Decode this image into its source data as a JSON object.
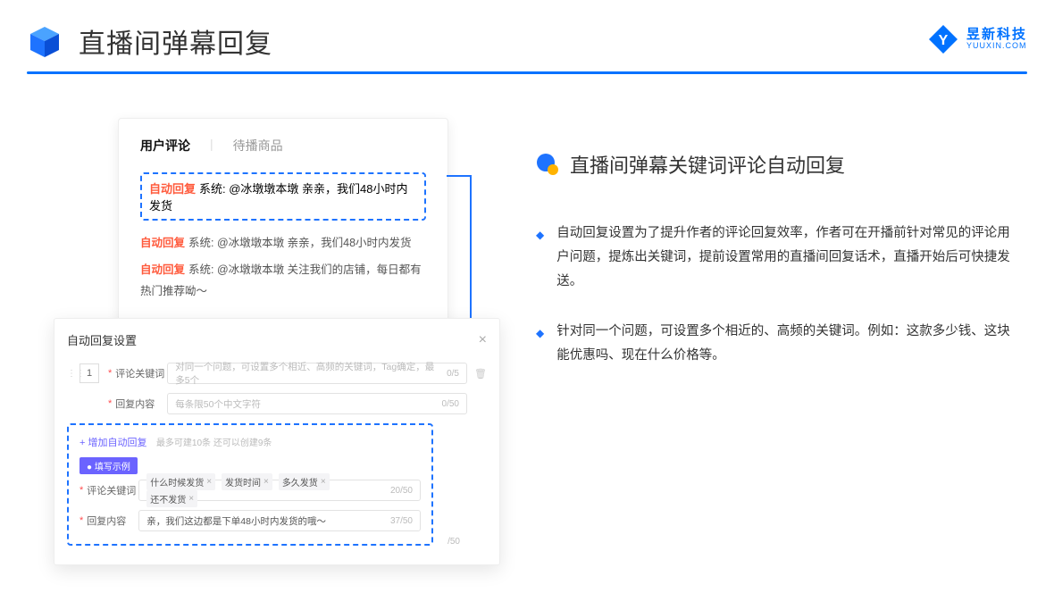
{
  "header": {
    "title": "直播间弹幕回复",
    "brand_name": "昱新科技",
    "brand_sub": "YUUXIN.COM"
  },
  "comments_card": {
    "tab_active": "用户评论",
    "tab_inactive": "待播商品",
    "row_hl": "系统: @冰墩墩本墩 亲亲，我们48小时内发货",
    "row2": "系统: @冰墩墩本墩 亲亲，我们48小时内发货",
    "row3": "系统: @冰墩墩本墩 关注我们的店铺，每日都有热门推荐呦～",
    "auto_tag": "自动回复"
  },
  "settings": {
    "title": "自动回复设置",
    "idx": "1",
    "label_kw": "评论关键词",
    "label_reply": "回复内容",
    "ph_kw": "对同一个问题，可设置多个相近、高频的关键词，Tag确定，最多5个",
    "cnt_kw": "0/5",
    "ph_reply": "每条限50个中文字符",
    "cnt_reply": "0/50",
    "add_link": "+ 增加自动回复",
    "add_hint": "最多可建10条 还可以创建9条",
    "badge": "● 填写示例",
    "ex_tags": [
      "什么时候发货",
      "发货时间",
      "多久发货",
      "还不发货"
    ],
    "ex_kw_cnt": "20/50",
    "ex_reply": "亲，我们这边都是下单48小时内发货的哦～",
    "ex_reply_cnt": "37/50",
    "stray_cnt": "/50"
  },
  "right": {
    "heading": "直播间弹幕关键词评论自动回复",
    "b1": "自动回复设置为了提升作者的评论回复效率，作者可在开播前针对常见的评论用户问题，提炼出关键词，提前设置常用的直播间回复话术，直播开始后可快捷发送。",
    "b2": "针对同一个问题，可设置多个相近的、高频的关键词。例如：这款多少钱、这块能优惠吗、现在什么价格等。"
  }
}
